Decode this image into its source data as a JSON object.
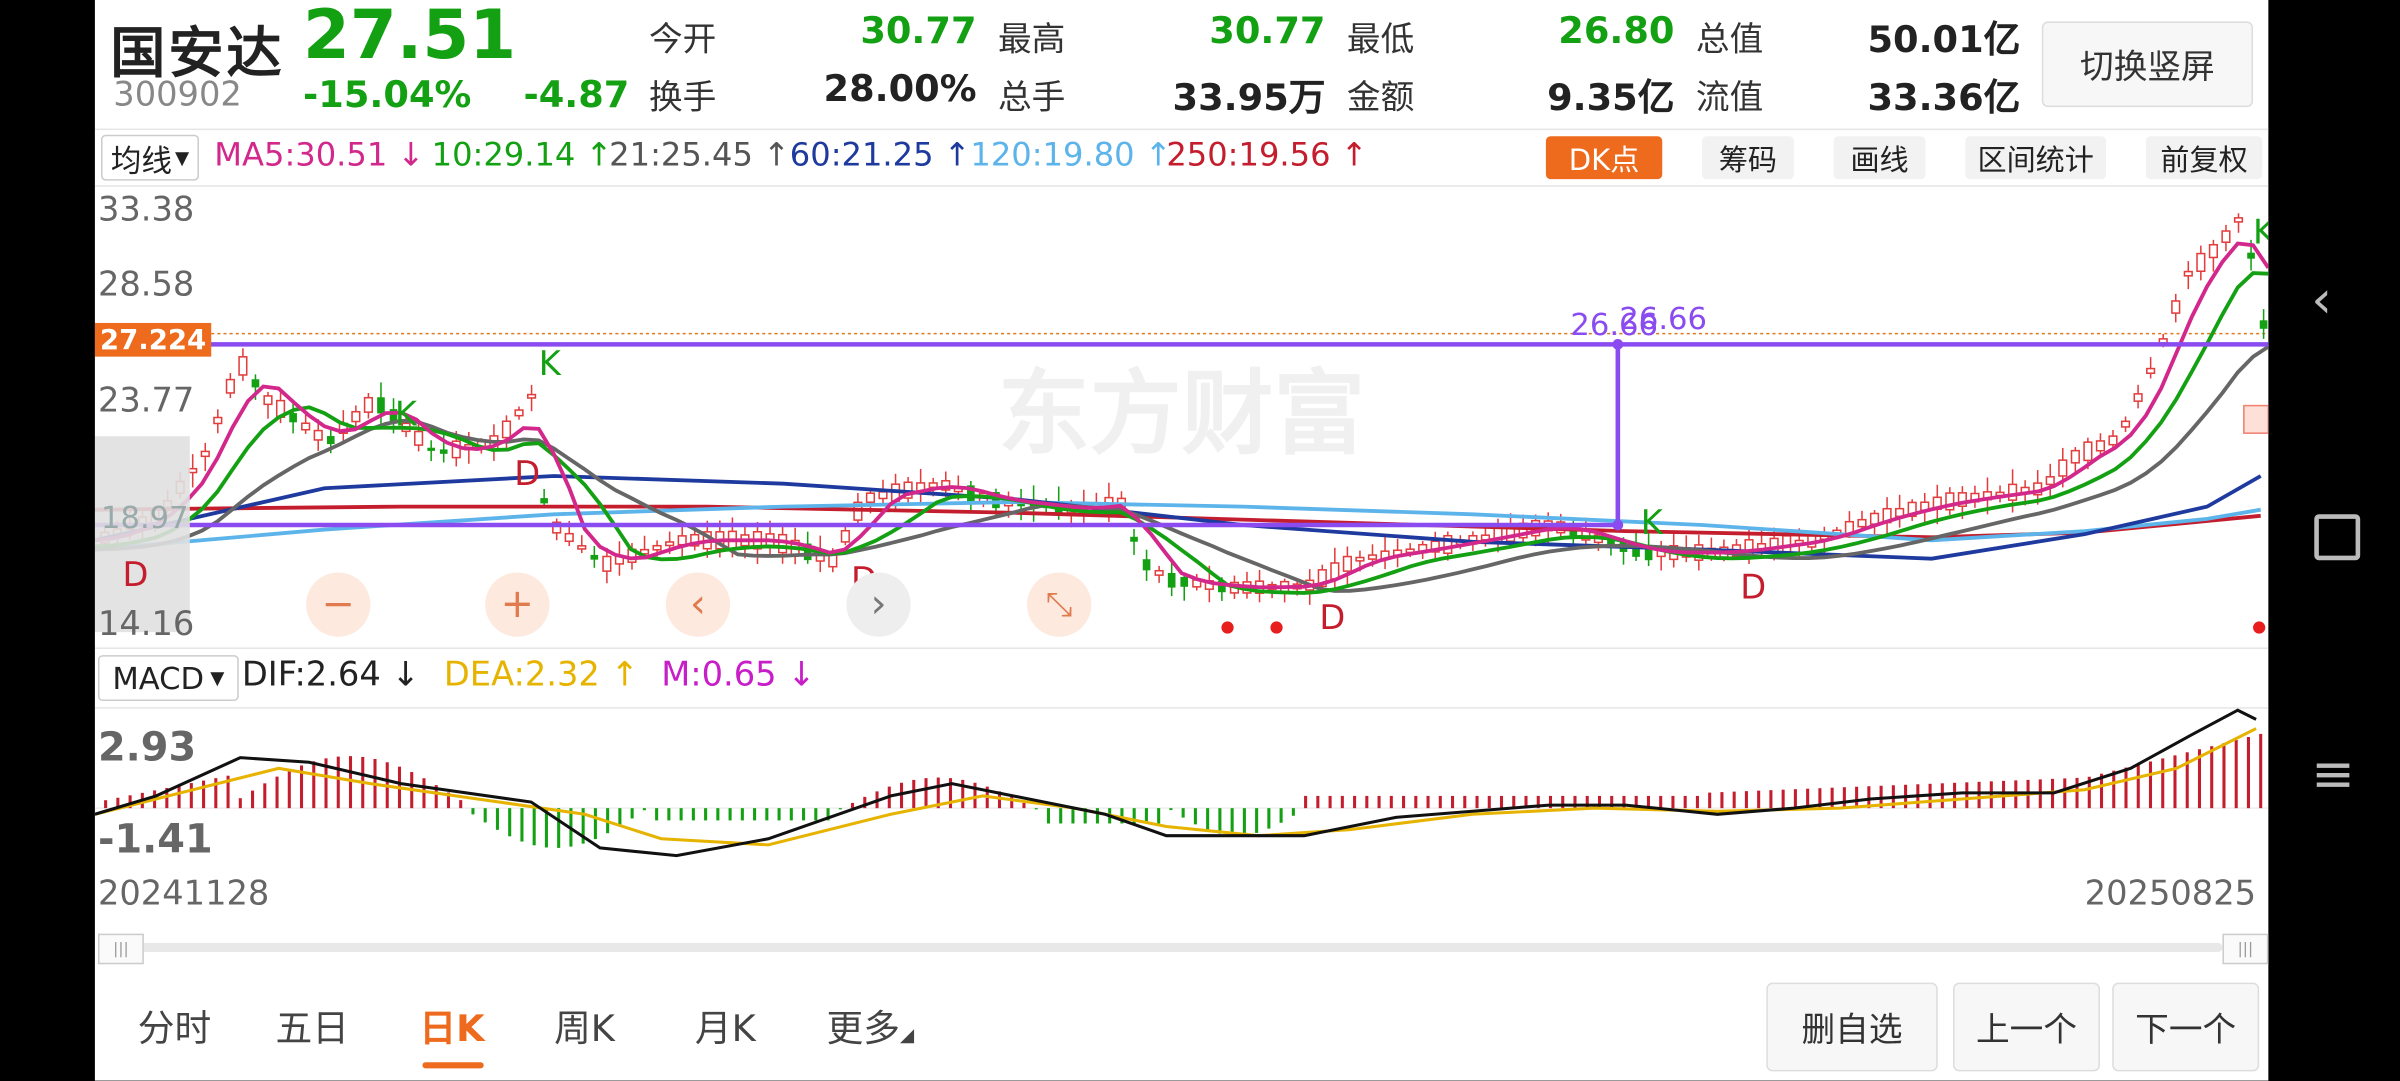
{
  "stock": {
    "name": "国安达",
    "price": "27.51",
    "code": "300902",
    "change_pct": "-15.04%",
    "change": "-4.87"
  },
  "quotes": [
    {
      "label": "今开",
      "value": "30.77"
    },
    {
      "label": "最高",
      "value": "30.77"
    },
    {
      "label": "最低",
      "value": "26.80"
    },
    {
      "label": "总值",
      "value": "50.01亿"
    },
    {
      "label": "换手",
      "value": "28.00%"
    },
    {
      "label": "总手",
      "value": "33.95万"
    },
    {
      "label": "金额",
      "value": "9.35亿"
    },
    {
      "label": "流值",
      "value": "33.36亿"
    }
  ],
  "switch_label": "切换竖屏",
  "indicator_select": "均线",
  "ma": [
    {
      "text": "MA5:30.51",
      "arrow": "↓",
      "color": "#d2288c"
    },
    {
      "text": "10:29.14",
      "arrow": "↑",
      "color": "#14a013"
    },
    {
      "text": "21:25.45",
      "arrow": "↑",
      "color": "#555555"
    },
    {
      "text": "60:21.25",
      "arrow": "↑",
      "color": "#1e3a9e"
    },
    {
      "text": "120:19.80",
      "arrow": "↑",
      "color": "#5cb4ea"
    },
    {
      "text": "250:19.56",
      "arrow": "↑",
      "color": "#c41e2e"
    }
  ],
  "tools": {
    "dk": "DK点",
    "chips": "筹码",
    "draw": "画线",
    "range": "区间统计",
    "adjust": "前复权"
  },
  "kline_axis": {
    "top": "33.38",
    "upper": "28.58",
    "mid": "23.77",
    "low": "14.16",
    "cursor_price": "27.224",
    "hidden_label": "18.97"
  },
  "annotation": {
    "label_a": "26.66",
    "label_b": "26.66"
  },
  "watermark": "东方财富",
  "macd_select": "MACD",
  "macd": [
    {
      "text": "DIF:2.64",
      "arrow": "↓",
      "color": "#222222"
    },
    {
      "text": "DEA:2.32",
      "arrow": "↑",
      "color": "#e6b400"
    },
    {
      "text": "M:0.65",
      "arrow": "↓",
      "color": "#c81ec8"
    }
  ],
  "macd_axis": {
    "top": "2.93",
    "bottom": "-1.41"
  },
  "dates": {
    "start": "20241128",
    "end": "20250825"
  },
  "periods": [
    "分时",
    "五日",
    "日K",
    "周K",
    "月K",
    "更多"
  ],
  "active_period": "日K",
  "actions": {
    "remove": "删自选",
    "prev": "上一个",
    "next": "下一个"
  },
  "colors": {
    "up": "#e23c3c",
    "down": "#14a013",
    "accent": "#ee6a1c",
    "draw_line": "#8a4cf0"
  }
}
